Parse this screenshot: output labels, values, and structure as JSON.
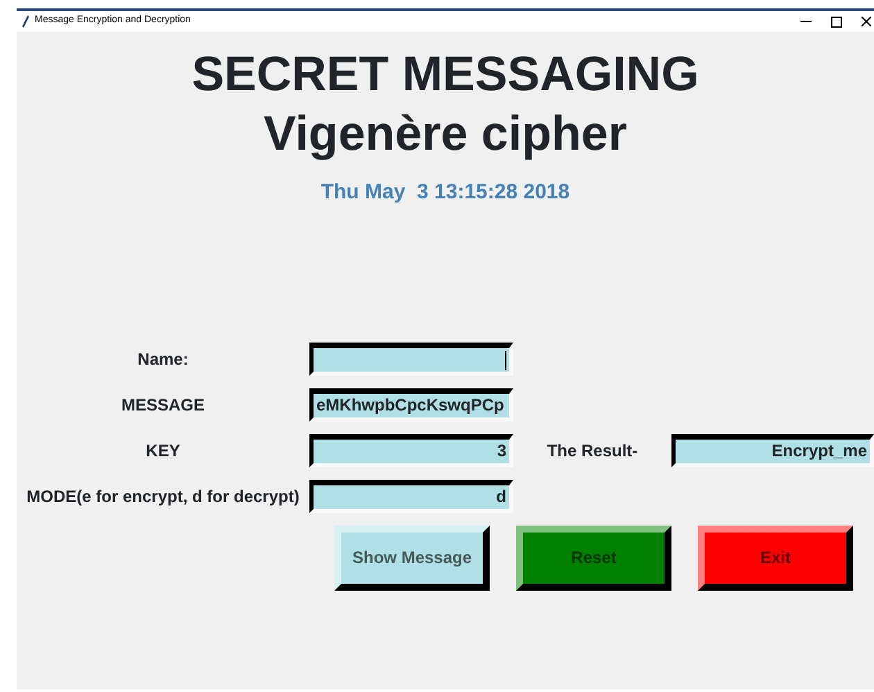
{
  "window": {
    "title": "Message Encryption and Decryption"
  },
  "headings": [
    "SECRET MESSAGING",
    "Vigenère cipher"
  ],
  "date": "Thu May  3 13:15:28 2018",
  "fields": [
    {
      "label": "Name:",
      "focused": true
    },
    {
      "label": "MESSAGE",
      "value": "eMKhwpbCpcKswqPCp",
      "focused": false
    },
    {
      "label": "KEY",
      "value": "3",
      "focused": false
    },
    {
      "label": "MODE(e for encrypt, d for decrypt)",
      "value": "d",
      "focused": false
    }
  ],
  "result": {
    "label": "The Result-",
    "value": "Encrypt_me"
  },
  "buttons": [
    {
      "label": "Show Message",
      "color": "#b0e0e6"
    },
    {
      "label": "Reset",
      "color": "#008000"
    },
    {
      "label": "Exit",
      "color": "#ff0000"
    }
  ]
}
